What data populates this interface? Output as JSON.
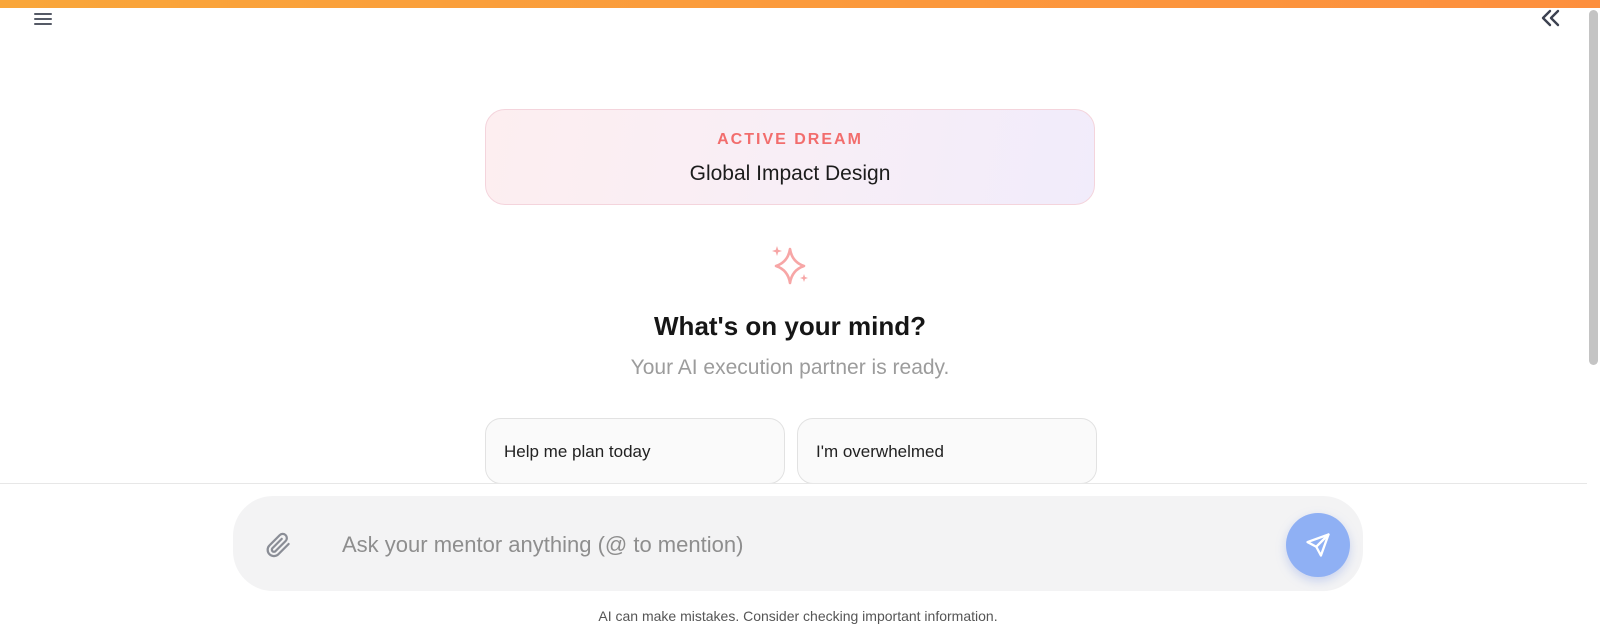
{
  "header": {
    "menu_icon": "hamburger-menu-icon",
    "collapse_icon": "double-chevron-left-icon",
    "accent_color": "#fb9a3c"
  },
  "dream": {
    "label": "ACTIVE DREAM",
    "title": "Global Impact Design",
    "label_color": "#f26d6d"
  },
  "welcome": {
    "icon": "sparkles-icon",
    "title": "What's on your mind?",
    "subtitle": "Your AI execution partner is ready."
  },
  "suggestions": [
    {
      "label": "Help me plan today"
    },
    {
      "label": "I'm overwhelmed"
    }
  ],
  "composer": {
    "attach_icon": "paperclip-icon",
    "placeholder": "Ask your mentor anything (@ to mention)",
    "value": "",
    "send_icon": "send-icon",
    "send_color": "#8fb0f4"
  },
  "footer": {
    "disclaimer": "AI can make mistakes. Consider checking important information."
  }
}
